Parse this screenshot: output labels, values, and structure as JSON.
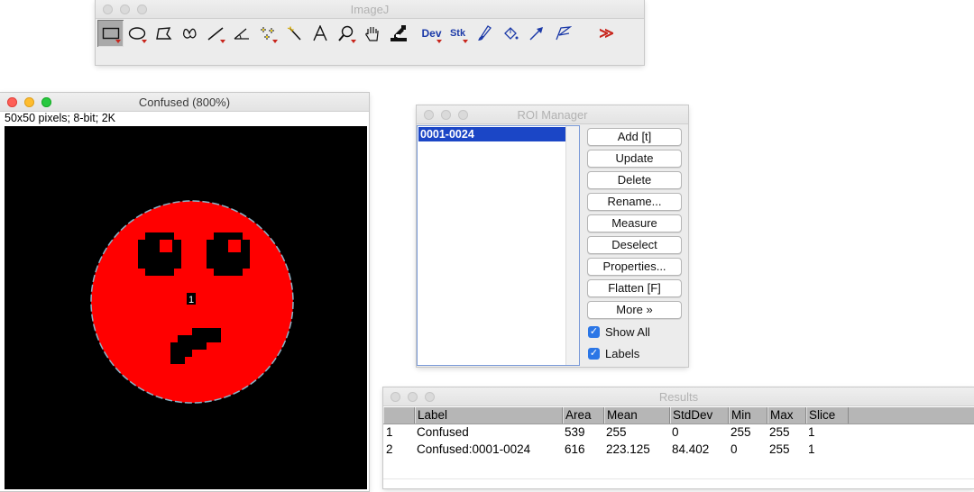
{
  "imagej": {
    "title": "ImageJ",
    "tools": [
      {
        "name": "rectangle-tool"
      },
      {
        "name": "oval-tool"
      },
      {
        "name": "polygon-tool"
      },
      {
        "name": "freehand-tool"
      },
      {
        "name": "line-tool"
      },
      {
        "name": "angle-tool"
      },
      {
        "name": "point-tool"
      },
      {
        "name": "wand-tool"
      },
      {
        "name": "text-tool"
      },
      {
        "name": "zoom-tool"
      },
      {
        "name": "hand-tool"
      },
      {
        "name": "dropper-tool"
      }
    ],
    "dev_label": "Dev",
    "stk_label": "Stk",
    "more_label": "≫"
  },
  "image_window": {
    "title": "Confused (800%)",
    "info": "50x50 pixels; 8-bit; 2K",
    "roi_label": "1"
  },
  "roi_manager": {
    "title": "ROI Manager",
    "items": [
      "0001-0024"
    ],
    "buttons": [
      "Add [t]",
      "Update",
      "Delete",
      "Rename...",
      "Measure",
      "Deselect",
      "Properties...",
      "Flatten [F]",
      "More »"
    ],
    "show_all": {
      "label": "Show All",
      "checked": true
    },
    "labels": {
      "label": "Labels",
      "checked": true
    }
  },
  "results": {
    "title": "Results",
    "columns": [
      "",
      "Label",
      "Area",
      "Mean",
      "StdDev",
      "Min",
      "Max",
      "Slice"
    ],
    "rows": [
      [
        "1",
        "Confused",
        "539",
        "255",
        "0",
        "255",
        "255",
        "1"
      ],
      [
        "2",
        "Confused:0001-0024",
        "616",
        "223.125",
        "84.402",
        "0",
        "255",
        "1"
      ]
    ]
  },
  "colors": {
    "face": "#ff0000",
    "outline": "#8ab4c8",
    "selection": "#1b46c6",
    "checkbox": "#2b76e6"
  }
}
